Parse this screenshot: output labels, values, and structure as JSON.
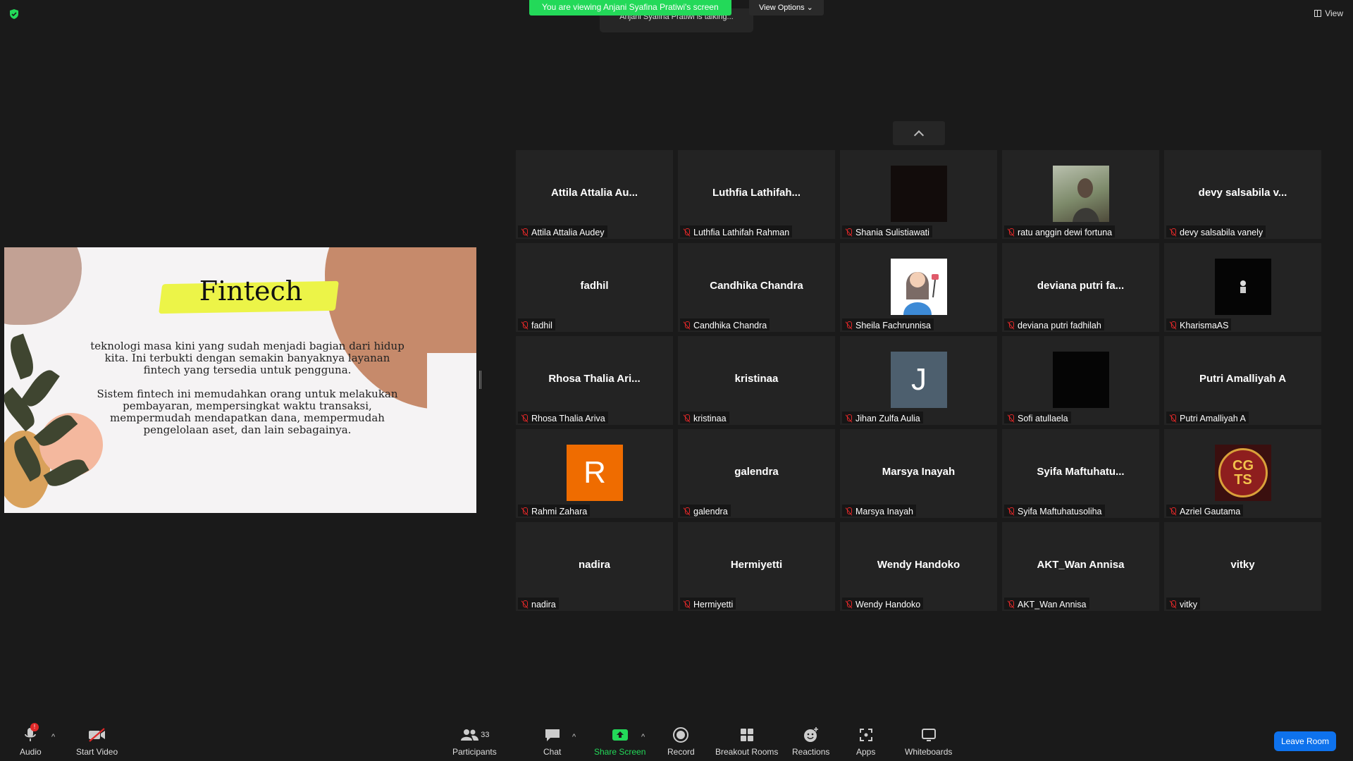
{
  "top": {
    "banner": "You are viewing Anjani Syafina Pratiwi's screen",
    "view_options": "View Options",
    "talking": "Anjani Syafina Pratiwi is talking...",
    "view": "View"
  },
  "slide": {
    "title": "Fintech",
    "p1": "teknologi masa kini yang sudah menjadi bagian dari hidup kita. Ini terbukti dengan semakin banyaknya layanan fintech yang tersedia untuk pengguna.",
    "p2": "Sistem fintech ini memudahkan orang untuk melakukan pembayaran, mempersingkat waktu transaksi, mempermudah mendapatkan dana, mempermudah pengelolaan aset, dan lain sebagainya."
  },
  "participants": [
    {
      "big": "Attila Attalia Au...",
      "name": "Attila Attalia Audey",
      "avatar": "none"
    },
    {
      "big": "Luthfia Lathifah...",
      "name": "Luthfia Lathifah Rahman",
      "avatar": "none"
    },
    {
      "big": "",
      "name": "Shania Sulistiawati",
      "avatar": "dark"
    },
    {
      "big": "",
      "name": "ratu anggin dewi fortuna",
      "avatar": "photo"
    },
    {
      "big": "devy salsabila v...",
      "name": "devy salsabila vanely",
      "avatar": "none"
    },
    {
      "big": "fadhil",
      "name": "fadhil",
      "avatar": "none"
    },
    {
      "big": "Candhika Chandra",
      "name": "Candhika Chandra",
      "avatar": "none"
    },
    {
      "big": "",
      "name": "Sheila Fachrunnisa",
      "avatar": "cartoon"
    },
    {
      "big": "deviana putri fa...",
      "name": "deviana putri fadhilah",
      "avatar": "none"
    },
    {
      "big": "",
      "name": "KharismaAS",
      "avatar": "black"
    },
    {
      "big": "Rhosa Thalia Ari...",
      "name": "Rhosa Thalia Ariva",
      "avatar": "none"
    },
    {
      "big": "kristinaa",
      "name": "kristinaa",
      "avatar": "none"
    },
    {
      "big": "",
      "name": "Jihan Zulfa Aulia",
      "avatar": "letter",
      "letter": "J",
      "color": "#4d5f6e"
    },
    {
      "big": "",
      "name": "Sofi atullaela",
      "avatar": "black"
    },
    {
      "big": "Putri Amalliyah A",
      "name": "Putri Amalliyah A",
      "avatar": "none"
    },
    {
      "big": "",
      "name": "Rahmi Zahara",
      "avatar": "letter",
      "letter": "R",
      "color": "#ef6c00"
    },
    {
      "big": "galendra",
      "name": "galendra",
      "avatar": "none"
    },
    {
      "big": "Marsya Inayah",
      "name": "Marsya Inayah",
      "avatar": "none"
    },
    {
      "big": "Syifa Maftuhatu...",
      "name": "Syifa Maftuhatusoliha",
      "avatar": "none"
    },
    {
      "big": "",
      "name": "Azriel Gautama",
      "avatar": "logo",
      "logo_text": "CG TS"
    },
    {
      "big": "nadira",
      "name": "nadira",
      "avatar": "none"
    },
    {
      "big": "Hermiyetti",
      "name": "Hermiyetti",
      "avatar": "none"
    },
    {
      "big": "Wendy Handoko",
      "name": "Wendy Handoko",
      "avatar": "none"
    },
    {
      "big": "AKT_Wan Annisa",
      "name": "AKT_Wan Annisa",
      "avatar": "none"
    },
    {
      "big": "vitky",
      "name": "vitky",
      "avatar": "none"
    }
  ],
  "toolbar": {
    "audio": "Audio",
    "audio_badge": "!",
    "start_video": "Start Video",
    "participants": "Participants",
    "participants_count": "33",
    "chat": "Chat",
    "share_screen": "Share Screen",
    "record": "Record",
    "breakout": "Breakout Rooms",
    "reactions": "Reactions",
    "apps": "Apps",
    "whiteboards": "Whiteboards",
    "leave": "Leave Room"
  },
  "colors": {
    "banner": "#23d959",
    "leave": "#0e72ed",
    "muted": "#e02828"
  }
}
